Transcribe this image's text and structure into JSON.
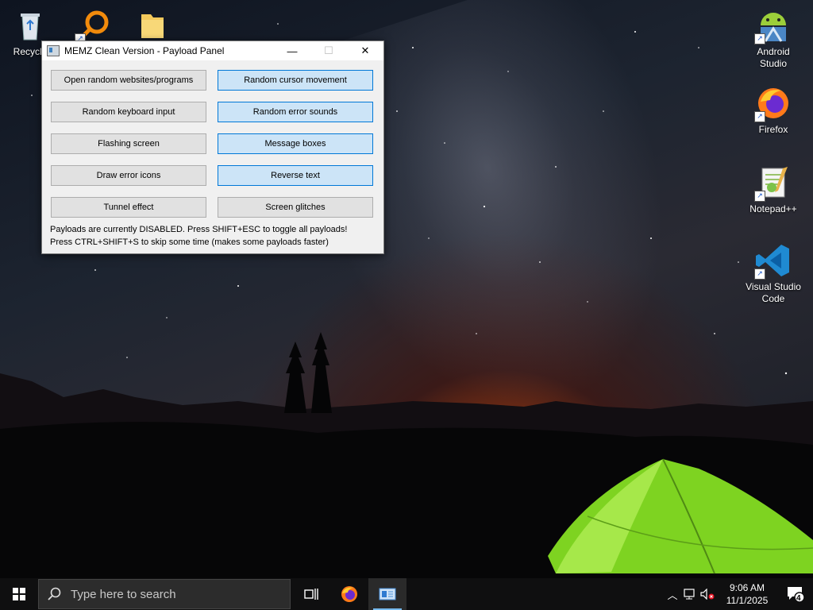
{
  "desktop": {
    "icons_left": [
      {
        "label": "Recycle",
        "icon": "recycle-bin-icon"
      },
      {
        "label": "",
        "icon": "search-tool-icon"
      },
      {
        "label": "",
        "icon": "folder-icon"
      }
    ],
    "icons_right": [
      {
        "label": "Android Studio",
        "icon": "android-studio-icon"
      },
      {
        "label": "Firefox",
        "icon": "firefox-icon"
      },
      {
        "label": "Notepad++",
        "icon": "notepad-plus-plus-icon"
      },
      {
        "label": "Visual Studio Code",
        "icon": "vscode-icon"
      }
    ]
  },
  "dialog": {
    "title": "MEMZ Clean Version - Payload Panel",
    "buttons": [
      {
        "label": "Open random websites/programs",
        "active": false
      },
      {
        "label": "Random cursor movement",
        "active": true
      },
      {
        "label": "Random keyboard input",
        "active": false
      },
      {
        "label": "Random error sounds",
        "active": true
      },
      {
        "label": "Flashing screen",
        "active": false
      },
      {
        "label": "Message boxes",
        "active": true
      },
      {
        "label": "Draw error icons",
        "active": false
      },
      {
        "label": "Reverse text",
        "active": true
      },
      {
        "label": "Tunnel effect",
        "active": false
      },
      {
        "label": "Screen glitches",
        "active": false
      }
    ],
    "status_line1": "Payloads are currently DISABLED. Press SHIFT+ESC to toggle all payloads!",
    "status_line2": "Press CTRL+SHIFT+S to skip some time (makes some payloads faster)"
  },
  "taskbar": {
    "search_placeholder": "Type here to search",
    "time": "9:06 AM",
    "date": "11/1/2025",
    "notification_count": "4"
  },
  "colors": {
    "active_button_bg": "#cce4f7",
    "active_button_border": "#0078d7",
    "tent_green": "#7ed321",
    "taskbar_bg": "#0f0f10"
  }
}
